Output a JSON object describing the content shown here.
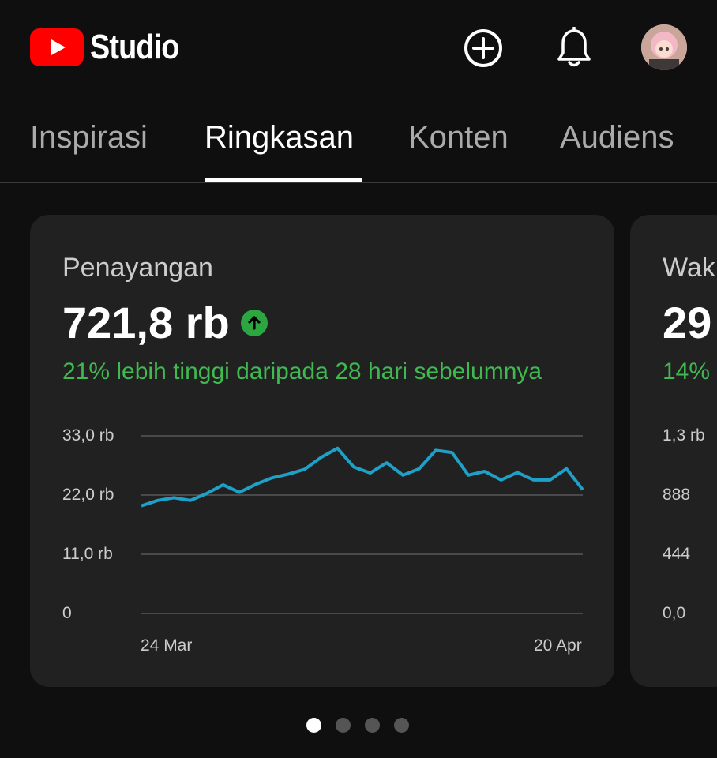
{
  "app": {
    "logo_text": "Studio"
  },
  "header": {
    "create_icon": "add-circle-icon",
    "notification_icon": "bell-icon",
    "avatar_icon": "avatar"
  },
  "tabs": [
    {
      "label": "Inspirasi",
      "active": false
    },
    {
      "label": "Ringkasan",
      "active": true
    },
    {
      "label": "Konten",
      "active": false
    },
    {
      "label": "Audiens",
      "active": false
    }
  ],
  "card_main": {
    "title": "Penayangan",
    "value": "721,8 rb",
    "change": "21% lebih tinggi daripada 28 hari sebelumnya",
    "trend_icon": "arrow-up-icon",
    "y_ticks": [
      "33,0 rb",
      "22,0 rb",
      "11,0 rb",
      "0"
    ],
    "x_ticks": [
      "24 Mar",
      "20 Apr"
    ]
  },
  "card_peek": {
    "title": "Wak",
    "value": "29",
    "change": "14%",
    "y_ticks": [
      "1,3 rb",
      "888",
      "444",
      "0,0"
    ]
  },
  "pager": {
    "count": 4,
    "active_index": 0
  },
  "colors": {
    "accent_line": "#1ea0c9",
    "positive": "#3fb950",
    "brand_red": "#ff0000"
  },
  "chart_data": {
    "type": "line",
    "title": "Penayangan",
    "x": [
      "24 Mar",
      "25 Mar",
      "26 Mar",
      "27 Mar",
      "28 Mar",
      "29 Mar",
      "30 Mar",
      "31 Mar",
      "1 Apr",
      "2 Apr",
      "3 Apr",
      "4 Apr",
      "5 Apr",
      "6 Apr",
      "7 Apr",
      "8 Apr",
      "9 Apr",
      "10 Apr",
      "11 Apr",
      "12 Apr",
      "13 Apr",
      "14 Apr",
      "15 Apr",
      "16 Apr",
      "17 Apr",
      "18 Apr",
      "19 Apr",
      "20 Apr"
    ],
    "values": [
      20000,
      21000,
      21500,
      21000,
      22300,
      23900,
      22500,
      24000,
      25200,
      25900,
      26800,
      29000,
      30700,
      27200,
      26100,
      28000,
      25700,
      26900,
      30300,
      29900,
      25700,
      26400,
      24800,
      26200,
      24800,
      24800,
      26900,
      23000
    ],
    "ylim": [
      0,
      33000
    ],
    "y_tick_labels": [
      "0",
      "11,0 rb",
      "22,0 rb",
      "33,0 rb"
    ],
    "x_tick_labels": [
      "24 Mar",
      "20 Apr"
    ],
    "grid": true
  }
}
